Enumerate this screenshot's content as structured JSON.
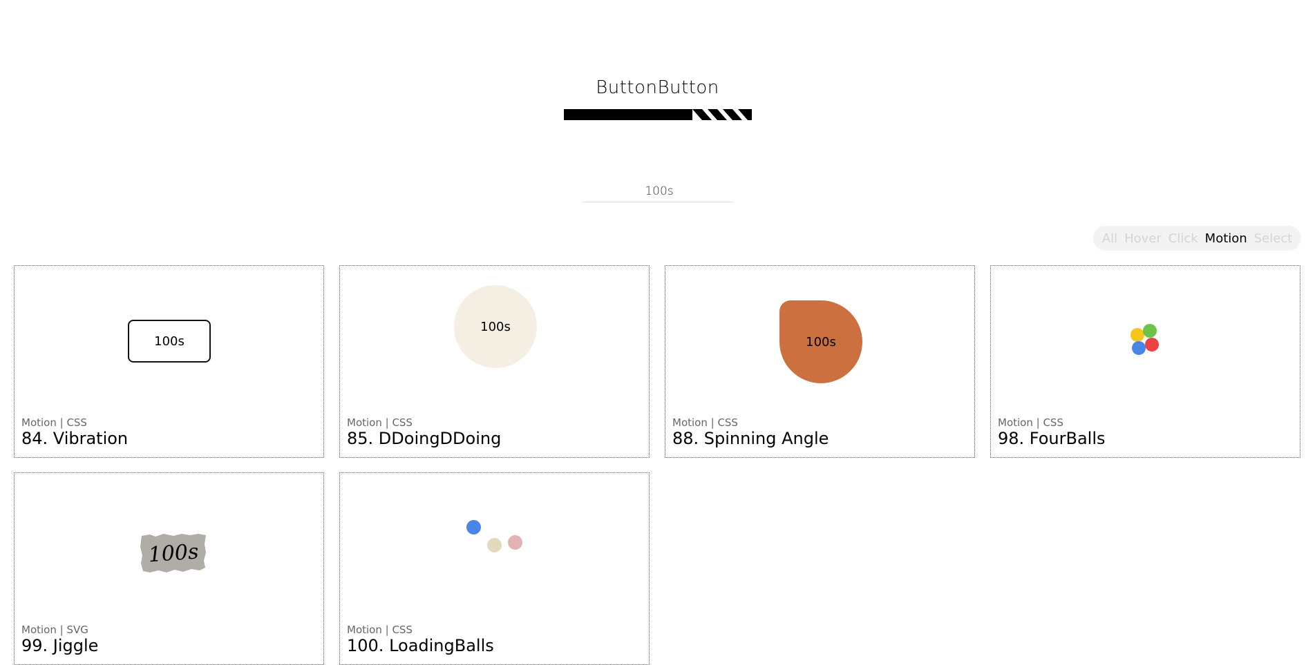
{
  "header": {
    "title": "ButtonButton"
  },
  "search": {
    "value": "100s"
  },
  "filters": [
    {
      "label": "All",
      "active": false
    },
    {
      "label": "Hover",
      "active": false
    },
    {
      "label": "Click",
      "active": false
    },
    {
      "label": "Motion",
      "active": true
    },
    {
      "label": "Select",
      "active": false
    }
  ],
  "cards": [
    {
      "meta": "Motion | CSS",
      "title": "84. Vibration",
      "button_label": "100s"
    },
    {
      "meta": "Motion | CSS",
      "title": "85. DDoingDDoing",
      "button_label": "100s"
    },
    {
      "meta": "Motion | CSS",
      "title": "88. Spinning Angle",
      "button_label": "100s"
    },
    {
      "meta": "Motion | CSS",
      "title": "98. FourBalls"
    },
    {
      "meta": "Motion | SVG",
      "title": "99. Jiggle",
      "button_label": "100s"
    },
    {
      "meta": "Motion | CSS",
      "title": "100. LoadingBalls"
    }
  ],
  "colors": {
    "angle": "#cc703f",
    "ddoing": "#f4efe2",
    "jiggle": "#b0ada6",
    "yellow": "#f5c51a",
    "green": "#6cc24a",
    "blue": "#4a86e8",
    "red": "#ea4343",
    "beige": "#e3d9bc",
    "pink": "#e3b3b3"
  }
}
